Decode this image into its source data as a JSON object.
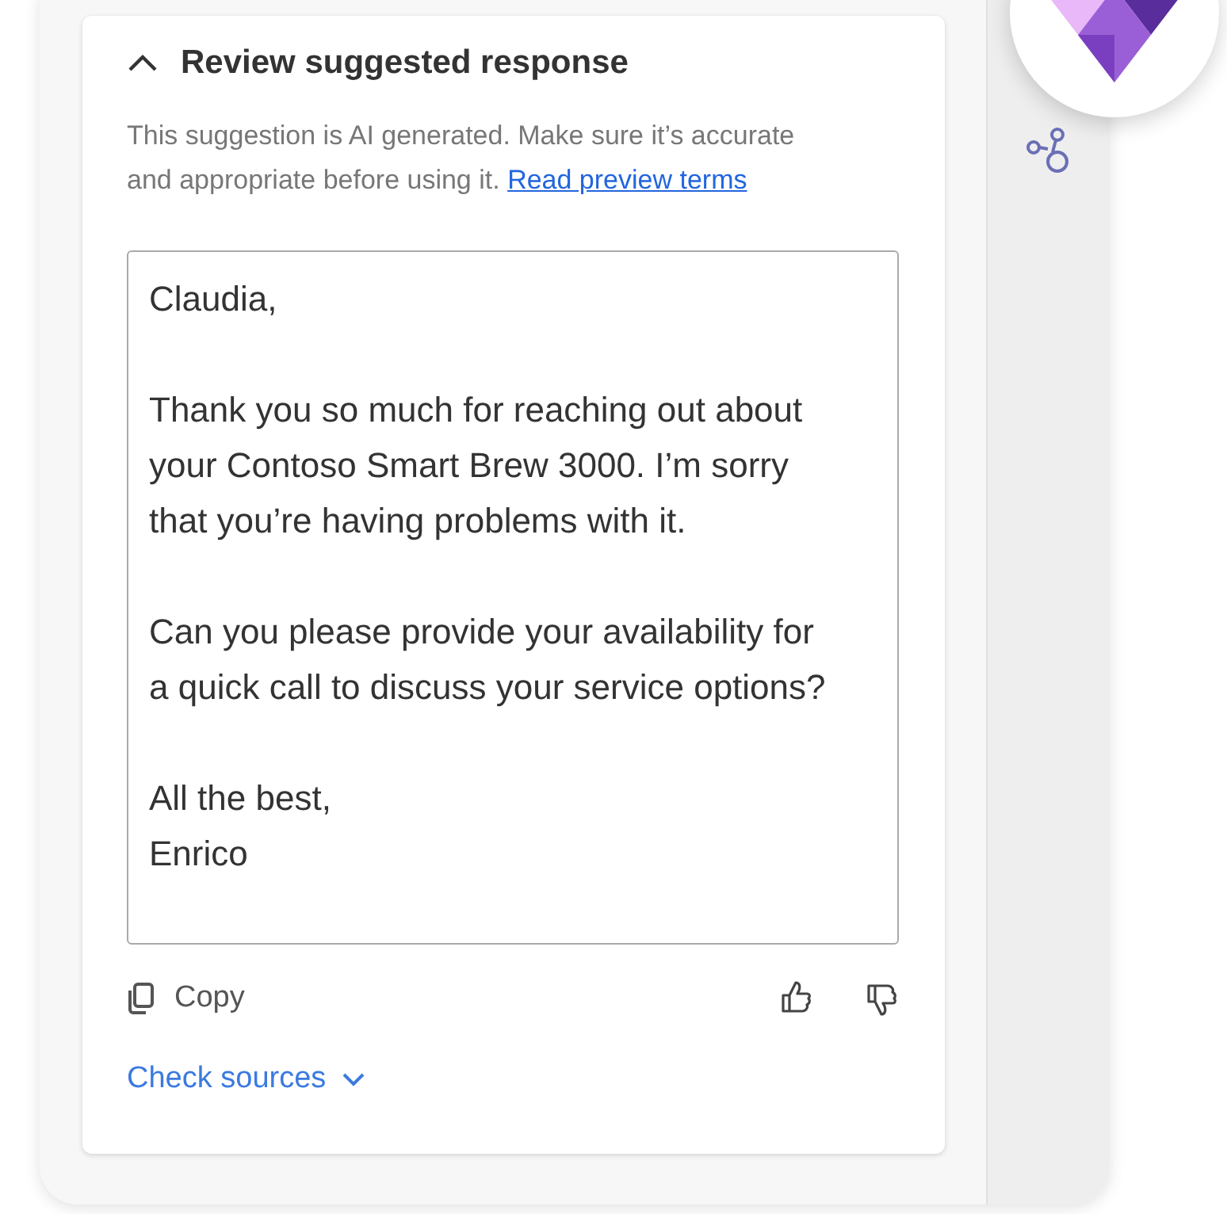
{
  "header": {
    "title": "Review suggested response",
    "expanded": true
  },
  "disclaimer": {
    "text": "This suggestion is AI generated. Make sure it’s accurate and appropriate before using it.",
    "link": "Read preview terms"
  },
  "response": {
    "paragraphs": [
      "Claudia,",
      "Thank you so much for reaching out about your Contoso Smart Brew 3000. I’m sorry that you’re having problems with it.",
      "Can you please provide your availability for a quick call to discuss your service options?",
      "All the best,\nEnrico"
    ]
  },
  "actions": {
    "copy": "Copy"
  },
  "sources": {
    "label": "Check sources",
    "expanded": false
  }
}
